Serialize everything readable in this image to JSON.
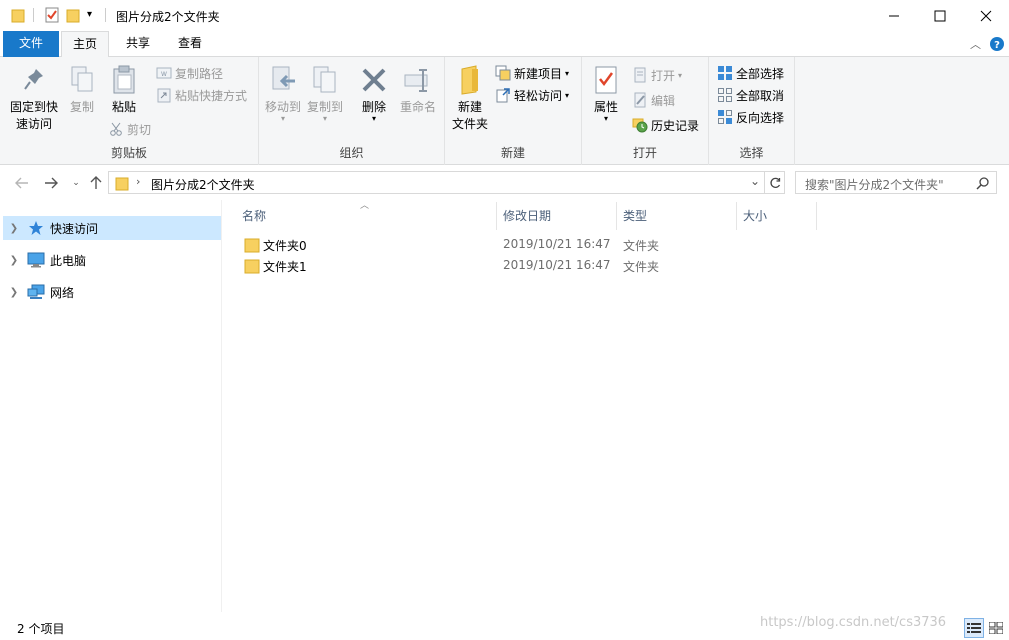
{
  "window": {
    "title": "图片分成2个文件夹",
    "minimize_glyph": "—",
    "maximize_glyph": "☐",
    "close_glyph": "✕"
  },
  "tabs": {
    "file": "文件",
    "home": "主页",
    "share": "共享",
    "view": "查看"
  },
  "ribbon": {
    "clipboard": {
      "label": "剪贴板",
      "pin_line1": "固定到快",
      "pin_line2": "速访问",
      "copy": "复制",
      "paste": "粘贴",
      "copy_path": "复制路径",
      "paste_shortcut": "粘贴快捷方式",
      "cut": "剪切"
    },
    "organize": {
      "label": "组织",
      "move_to": "移动到",
      "copy_to": "复制到",
      "delete": "删除",
      "rename": "重命名"
    },
    "new": {
      "label": "新建",
      "new_folder_line1": "新建",
      "new_folder_line2": "文件夹",
      "new_item": "新建项目",
      "easy_access": "轻松访问"
    },
    "open": {
      "label": "打开",
      "properties": "属性",
      "open": "打开",
      "edit": "编辑",
      "history": "历史记录"
    },
    "select": {
      "label": "选择",
      "select_all": "全部选择",
      "select_none": "全部取消",
      "invert": "反向选择"
    }
  },
  "address": {
    "path": "图片分成2个文件夹",
    "search_placeholder": "搜索\"图片分成2个文件夹\""
  },
  "nav": [
    {
      "label": "快速访问",
      "icon": "star-icon"
    },
    {
      "label": "此电脑",
      "icon": "computer-icon"
    },
    {
      "label": "网络",
      "icon": "network-icon"
    }
  ],
  "columns": {
    "name": "名称",
    "modified": "修改日期",
    "type": "类型",
    "size": "大小"
  },
  "files": [
    {
      "name": "文件夹0",
      "modified": "2019/10/21 16:47",
      "type": "文件夹",
      "size": ""
    },
    {
      "name": "文件夹1",
      "modified": "2019/10/21 16:47",
      "type": "文件夹",
      "size": ""
    }
  ],
  "status": {
    "count": "2 个项目"
  },
  "watermark": "https://blog.csdn.net/cs3736",
  "colors": {
    "accent": "#1979ca",
    "selection": "#cce8ff",
    "folder": "#f7d060"
  }
}
